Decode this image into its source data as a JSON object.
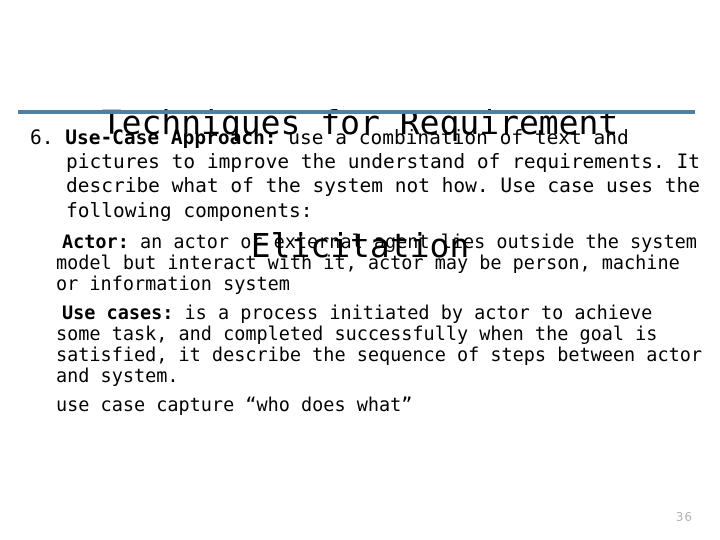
{
  "slide": {
    "page_number": "36",
    "accent_color": "#4f7fa3",
    "title": {
      "line1": "Techniques for Requirement",
      "line2": "Elicitation"
    },
    "numbered_item": {
      "number": "6.",
      "lead": " Use-Case Approach:",
      "text": " use a combination of text and pictures to improve the understand of requirements. It describe what of the system not how. Use case uses the following components:"
    },
    "sub_items": [
      {
        "lead": "Actor:",
        "text": " an actor or external agent lies outside the system model but interact with it, actor may be person, machine or information system"
      },
      {
        "lead": "Use cases:",
        "text": " is a process initiated by actor to achieve some task, and completed successfully when the goal is satisfied, it describe the sequence of steps between actor and system."
      }
    ],
    "closing_line": "use case capture “who does what”"
  }
}
